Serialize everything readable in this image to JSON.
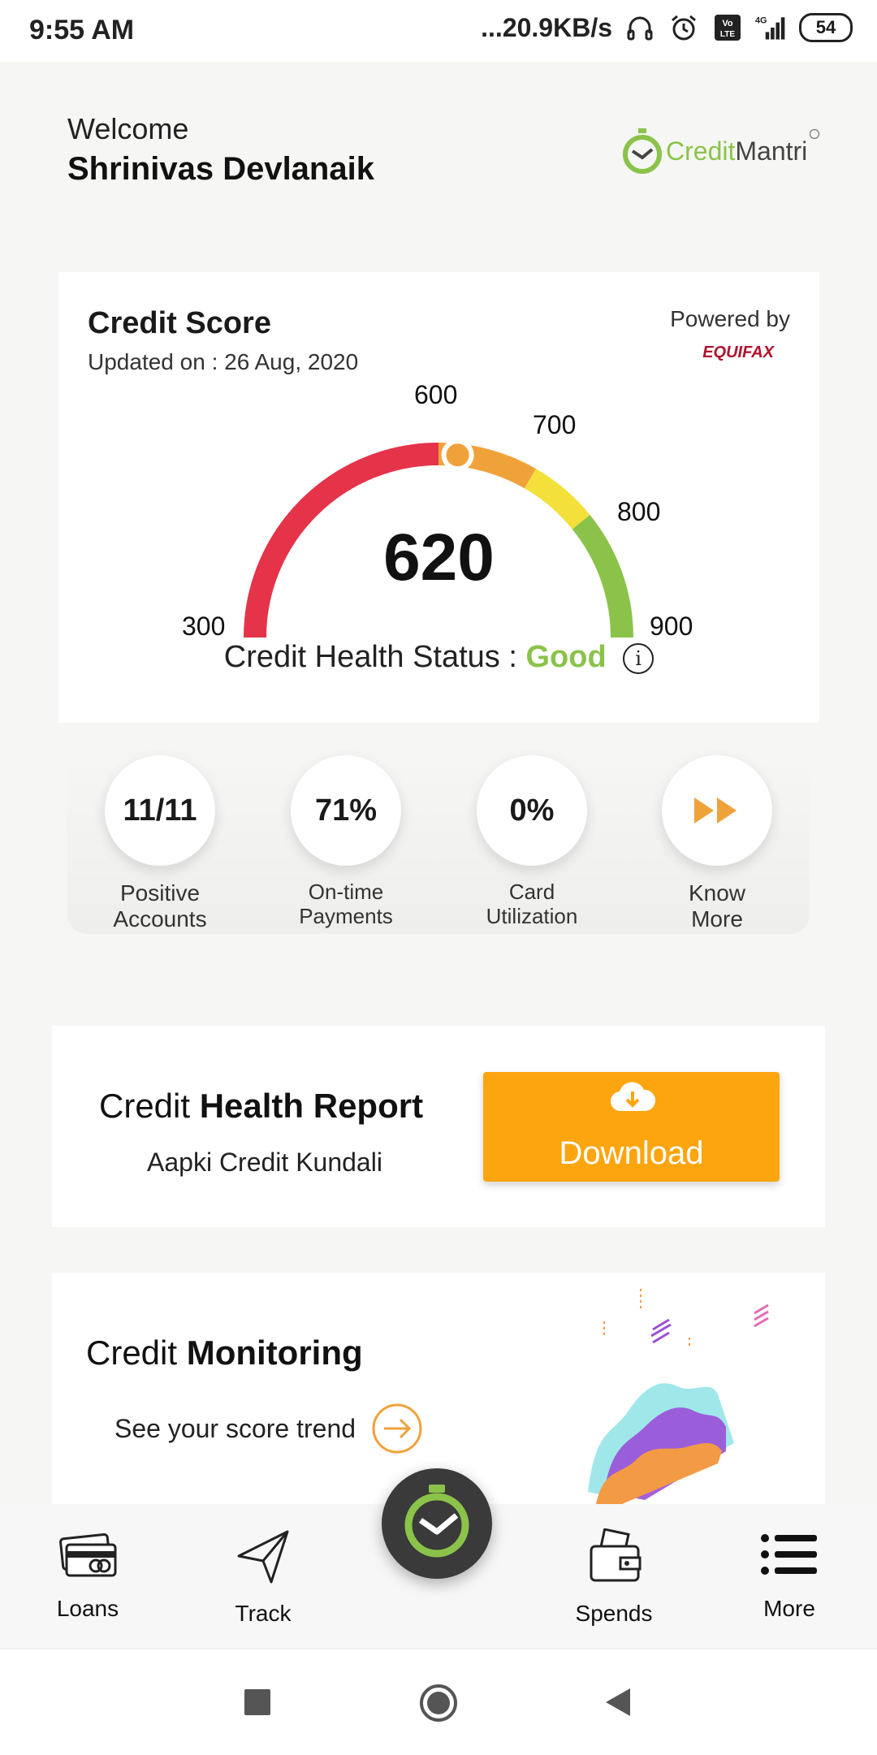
{
  "status_bar": {
    "time": "9:55 AM",
    "network_speed": "...20.9KB/s",
    "battery": "54",
    "icons": [
      "headphones-icon",
      "alarm-icon",
      "volte-icon",
      "signal-4g-icon",
      "battery-icon"
    ]
  },
  "header": {
    "welcome": "Welcome",
    "username": "Shrinivas Devlanaik",
    "logo_text_a": "Credit",
    "logo_text_b": "Mantri"
  },
  "score_card": {
    "title": "Credit Score",
    "updated": "Updated on : 26 Aug, 2020",
    "powered_by": "Powered by",
    "bureau": "EQUIFAX",
    "score": "620",
    "score_value": 620,
    "range": [
      300,
      900
    ],
    "ticks": [
      "300",
      "600",
      "700",
      "800",
      "900"
    ],
    "health_label": "Credit Health Status :",
    "health_value": "Good",
    "colors": {
      "poor": "#e5334a",
      "fair": "#f0a23a",
      "ok": "#f4e03a",
      "good": "#8bc34a"
    }
  },
  "stats": [
    {
      "value": "11/11",
      "label": "Positive Accounts"
    },
    {
      "value": "71%",
      "label": "On-time Payments"
    },
    {
      "value": "0%",
      "label": "Card Utilization"
    },
    {
      "value": "",
      "label": "Know More"
    }
  ],
  "report": {
    "title_a": "Credit",
    "title_b": "Health Report",
    "subtitle": "Aapki Credit Kundali",
    "button": "Download"
  },
  "monitoring": {
    "title_a": "Credit",
    "title_b": "Monitoring",
    "subtitle": "See your score trend"
  },
  "bottom_nav": [
    {
      "label": "Loans",
      "icon": "cards-icon"
    },
    {
      "label": "Track",
      "icon": "send-icon"
    },
    {
      "label": "",
      "icon": "creditmantri-clock-icon"
    },
    {
      "label": "Spends",
      "icon": "wallet-icon"
    },
    {
      "label": "More",
      "icon": "menu-list-icon"
    }
  ],
  "accent": "#fda50f"
}
